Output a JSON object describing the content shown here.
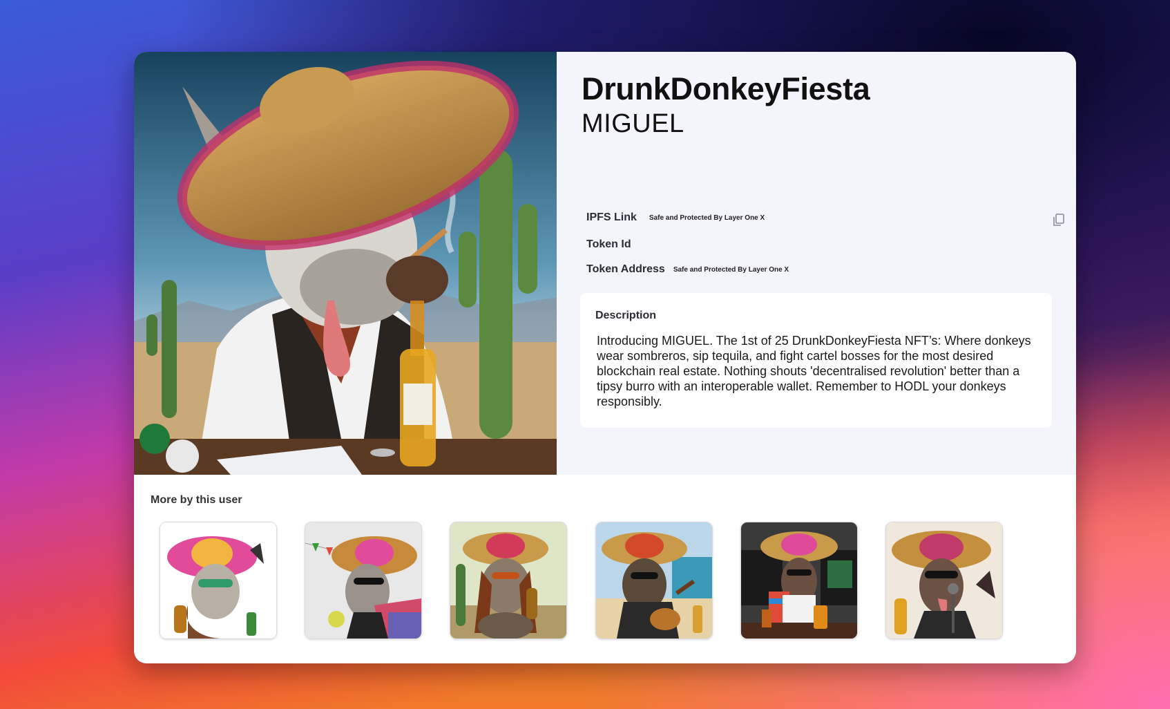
{
  "colors": {
    "panel_bg": "#f4f4fd",
    "card_bg": "#ffffff",
    "text": "#111111",
    "label": "#2b2b33"
  },
  "nft": {
    "collection": "DrunkDonkeyFiesta",
    "name": "MIGUEL",
    "image_alt_icon": "donkey-sombrero-image"
  },
  "meta": {
    "ipfs_label": "IPFS Link",
    "ipfs_value": "Safe and Protected By Layer One X",
    "token_id_label": "Token Id",
    "token_address_label": "Token Address",
    "token_address_value": "Safe and Protected By Layer One X",
    "copy_icon": "copy-icon"
  },
  "description": {
    "title": "Description",
    "text": "Introducing MIGUEL. The 1st of 25 DrunkDonkeyFiesta NFT’s: Where donkeys wear sombreros, sip tequila, and fight cartel bosses for the most desired blockchain real estate. Nothing shouts 'decentralised revolution' better than a tipsy burro with an interoperable wallet. Remember to HODL your donkeys responsibly."
  },
  "more": {
    "title": "More by this user",
    "thumbnail_count": 6
  }
}
